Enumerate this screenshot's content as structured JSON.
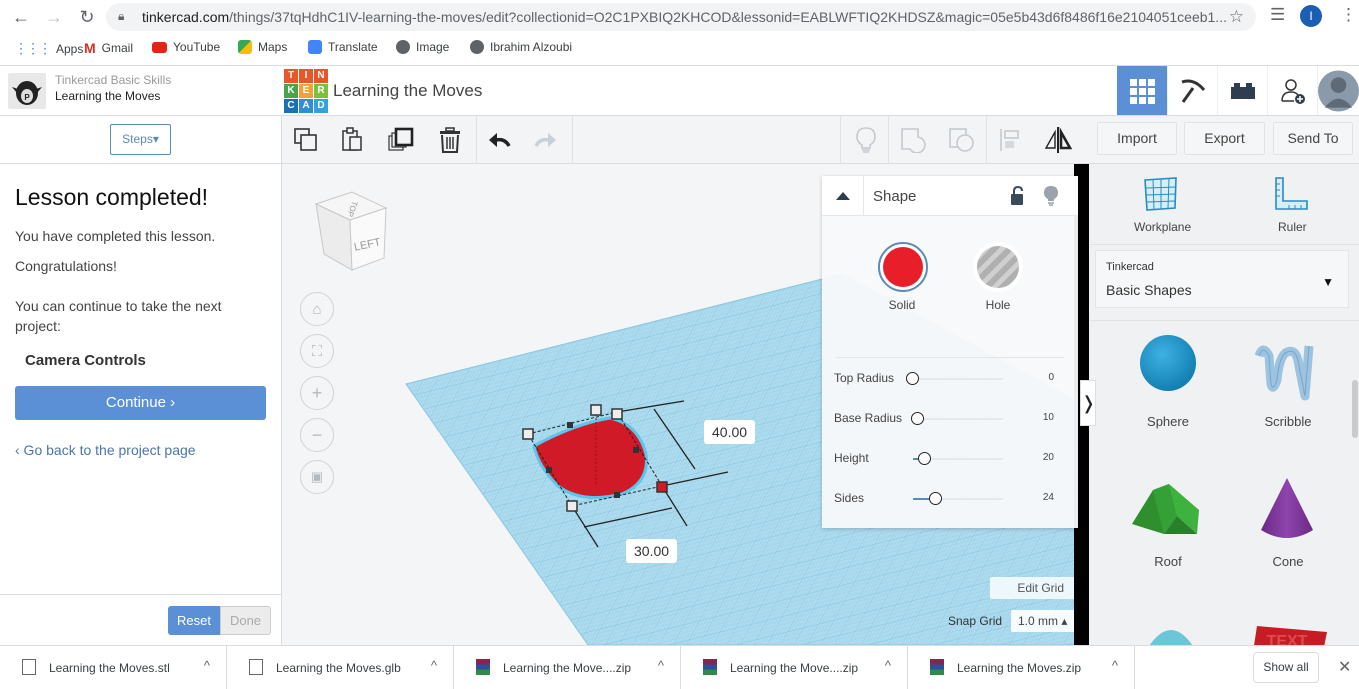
{
  "browser": {
    "url_host": "tinkercad.com",
    "url_path": "/things/37tqHdhC1IV-learning-the-moves/edit?collectionid=O2C1PXBIQ2KHCOD&lessonid=EABLWFTIQ2KHDSZ&magic=05e5b43d6f8486f16e2104051ceeb1...",
    "profile_initial": "I",
    "bookmarks": [
      {
        "label": "Apps",
        "icon": "apps-grid-icon"
      },
      {
        "label": "Gmail",
        "icon": "gmail-icon"
      },
      {
        "label": "YouTube",
        "icon": "youtube-icon"
      },
      {
        "label": "Maps",
        "icon": "maps-icon"
      },
      {
        "label": "Translate",
        "icon": "translate-icon"
      },
      {
        "label": "Image",
        "icon": "globe-icon"
      },
      {
        "label": "Ibrahim Alzoubi",
        "icon": "globe-icon"
      }
    ]
  },
  "header": {
    "course": "Tinkercad Basic Skills",
    "lesson": "Learning the Moves",
    "logo_letters": [
      "T",
      "I",
      "N",
      "K",
      "E",
      "R",
      "C",
      "A",
      "D"
    ],
    "logo_colors": [
      "#e8562a",
      "#e8562a",
      "#e8562a",
      "#4aa54a",
      "#f0a23a",
      "#7bbf3a",
      "#1b6fb3",
      "#2f8fd0",
      "#3aa0dc"
    ],
    "design_title": "Learning the Moves",
    "accent": "#5b90d6"
  },
  "left_panel": {
    "steps_label": "Steps▾",
    "heading": "Lesson completed!",
    "line1": "You have completed this lesson.",
    "line2": "Congratulations!",
    "line3": "You can continue to take the next project:",
    "next_project": "Camera Controls",
    "continue_label": "Continue ›",
    "go_back_label": "‹ Go back to the project page",
    "reset_label": "Reset",
    "done_label": "Done"
  },
  "toolbar": {
    "import_label": "Import",
    "export_label": "Export",
    "send_to_label": "Send To"
  },
  "viewport": {
    "view_cube_face": "LEFT",
    "view_cube_top": "TOP",
    "dim_depth": "40.00",
    "dim_width": "30.00",
    "edit_grid_label": "Edit Grid",
    "snap_grid_label": "Snap Grid",
    "snap_grid_value": "1.0 mm ▴"
  },
  "inspector": {
    "title": "Shape",
    "solid_label": "Solid",
    "hole_label": "Hole",
    "solid_color": "#e81e2b",
    "params": [
      {
        "label": "Top Radius",
        "value": "0",
        "fraction": 0.0
      },
      {
        "label": "Base Radius",
        "value": "10",
        "fraction": 0.06
      },
      {
        "label": "Height",
        "value": "20",
        "fraction": 0.13
      },
      {
        "label": "Sides",
        "value": "24",
        "fraction": 0.26
      }
    ]
  },
  "right_panel": {
    "workplane_label": "Workplane",
    "ruler_label": "Ruler",
    "library_sub": "Tinkercad",
    "library_main": "Basic Shapes",
    "shapes": [
      {
        "label": "Sphere"
      },
      {
        "label": "Scribble"
      },
      {
        "label": "Roof"
      },
      {
        "label": "Cone"
      }
    ]
  },
  "downloads": {
    "items": [
      {
        "name": "Learning the Moves.stl",
        "type": "file"
      },
      {
        "name": "Learning the Moves.glb",
        "type": "file"
      },
      {
        "name": "Learning the Move....zip",
        "type": "zip"
      },
      {
        "name": "Learning the Move....zip",
        "type": "zip"
      },
      {
        "name": "Learning the Moves.zip",
        "type": "zip"
      }
    ],
    "show_all_label": "Show all"
  }
}
